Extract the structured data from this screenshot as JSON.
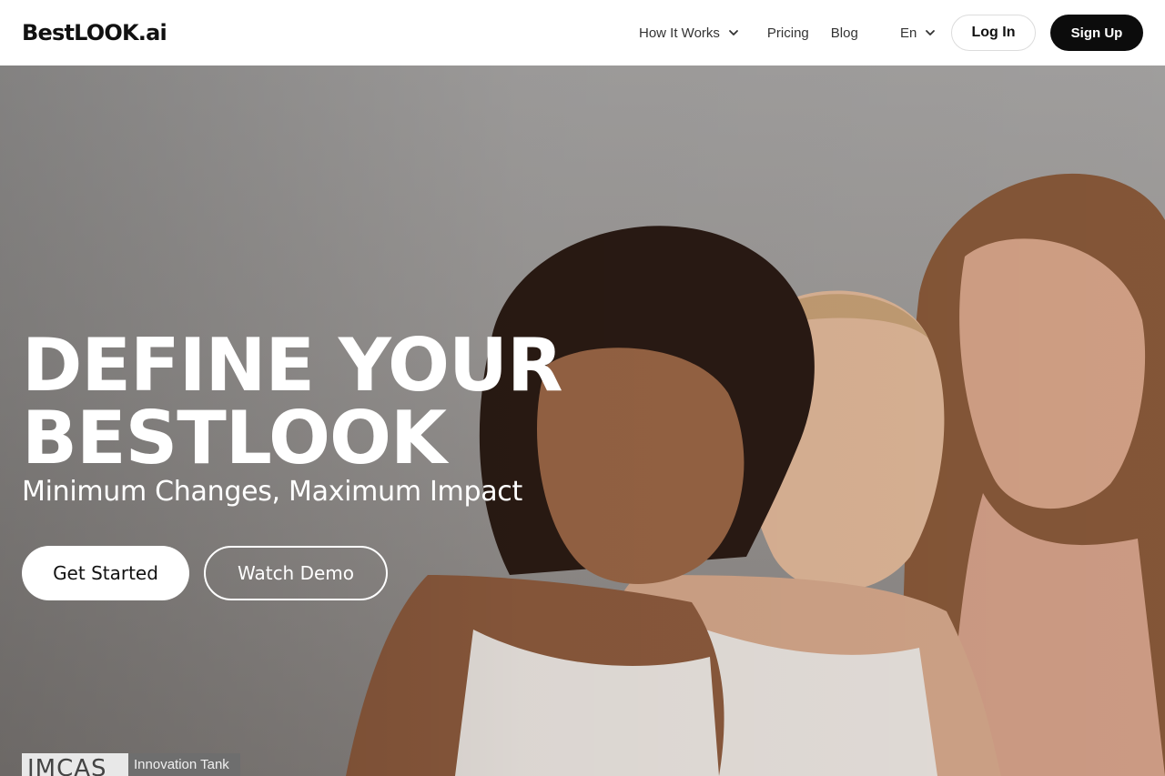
{
  "header": {
    "logo": "BestLOOK.ai",
    "nav": {
      "how_it_works": "How It Works",
      "pricing": "Pricing",
      "blog": "Blog"
    },
    "language": "En",
    "login_label": "Log In",
    "signup_label": "Sign Up"
  },
  "hero": {
    "title_line1": "DEFINE YOUR",
    "title_line2": "BESTLOOK",
    "subtitle": "Minimum Changes, Maximum Impact",
    "get_started_label": "Get Started",
    "watch_demo_label": "Watch Demo",
    "badge_mark": "IMCAS",
    "badge_tag": "Innovation Tank"
  },
  "icons": {
    "nav_dropdown": "chevron-down-icon",
    "language_dropdown": "chevron-down-icon"
  },
  "colors": {
    "header_bg": "#ffffff",
    "signup_bg": "#0c0c0c",
    "hero_bg": "#a8a6a5",
    "hero_text": "#ffffff"
  }
}
